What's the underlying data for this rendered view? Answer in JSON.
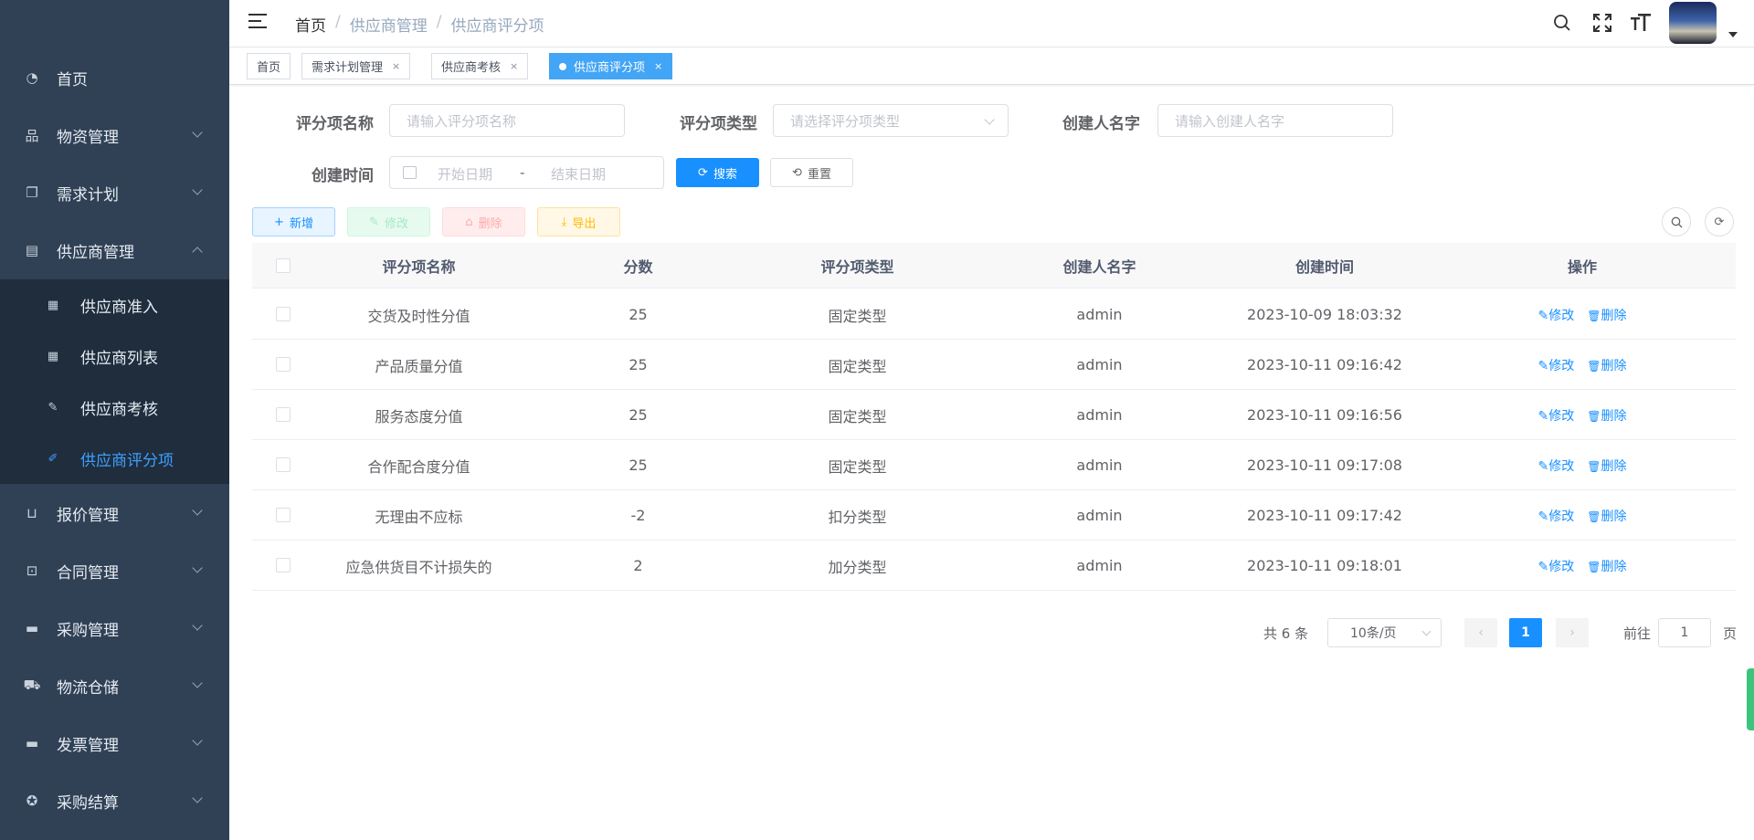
{
  "sidebar": {
    "items": [
      {
        "label": "首页",
        "icon": "dashboard-icon",
        "glyph": "◔"
      },
      {
        "label": "物资管理",
        "icon": "sitemap-icon",
        "glyph": "品"
      },
      {
        "label": "需求计划",
        "icon": "clipboard-icon",
        "glyph": "❐"
      },
      {
        "label": "供应商管理",
        "icon": "table-icon",
        "glyph": "▤"
      },
      {
        "label": "报价管理",
        "icon": "book-icon",
        "glyph": "⊔"
      },
      {
        "label": "合同管理",
        "icon": "briefcase-icon",
        "glyph": "⊡"
      },
      {
        "label": "采购管理",
        "icon": "document-icon",
        "glyph": "▬"
      },
      {
        "label": "物流仓储",
        "icon": "truck-icon",
        "glyph": "⛟"
      },
      {
        "label": "发票管理",
        "icon": "invoice-icon",
        "glyph": "▬"
      },
      {
        "label": "采购结算",
        "icon": "lifebuoy-icon",
        "glyph": "✪"
      }
    ],
    "sub_items": [
      {
        "label": "供应商准入",
        "icon": "grid-icon",
        "glyph": "▦"
      },
      {
        "label": "供应商列表",
        "icon": "grid-icon",
        "glyph": "▦"
      },
      {
        "label": "供应商考核",
        "icon": "edit-icon",
        "glyph": "✎"
      },
      {
        "label": "供应商评分项",
        "icon": "chart-edit-icon",
        "glyph": "✐"
      }
    ]
  },
  "header": {
    "breadcrumb": {
      "home": "首页",
      "sep": "/",
      "level1": "供应商管理",
      "level2": "供应商评分项"
    }
  },
  "tags": [
    {
      "label": "首页"
    },
    {
      "label": "需求计划管理",
      "close": "×"
    },
    {
      "label": "供应商考核",
      "close": "×"
    },
    {
      "label": "供应商评分项",
      "close": "×"
    }
  ],
  "search": {
    "name_label": "评分项名称",
    "name_placeholder": "请输入评分项名称",
    "type_label": "评分项类型",
    "type_placeholder": "请选择评分项类型",
    "creator_label": "创建人名字",
    "creator_placeholder": "请输入创建人名字",
    "time_label": "创建时间",
    "start_placeholder": "开始日期",
    "range_sep": "-",
    "end_placeholder": "结束日期",
    "search_btn": "搜索",
    "reset_btn": "重置"
  },
  "toolbar": {
    "add": "新增",
    "edit": "修改",
    "delete": "删除",
    "export": "导出"
  },
  "table": {
    "columns": [
      "评分项名称",
      "分数",
      "评分项类型",
      "创建人名字",
      "创建时间",
      "操作"
    ],
    "rows": [
      {
        "name": "交货及时性分值",
        "score": "25",
        "type": "固定类型",
        "creator": "admin",
        "time": "2023-10-09 18:03:32"
      },
      {
        "name": "产品质量分值",
        "score": "25",
        "type": "固定类型",
        "creator": "admin",
        "time": "2023-10-11 09:16:42"
      },
      {
        "name": "服务态度分值",
        "score": "25",
        "type": "固定类型",
        "creator": "admin",
        "time": "2023-10-11 09:16:56"
      },
      {
        "name": "合作配合度分值",
        "score": "25",
        "type": "固定类型",
        "creator": "admin",
        "time": "2023-10-11 09:17:08"
      },
      {
        "name": "无理由不应标",
        "score": "-2",
        "type": "扣分类型",
        "creator": "admin",
        "time": "2023-10-11 09:17:42"
      },
      {
        "name": "应急供货目不计损失的",
        "score": "2",
        "type": "加分类型",
        "creator": "admin",
        "time": "2023-10-11 09:18:01"
      }
    ],
    "row_edit": "修改",
    "row_delete": "删除"
  },
  "pagination": {
    "total": "共 6 条",
    "page_size": "10条/页",
    "current": "1",
    "goto_label": "前往",
    "goto_value": "1",
    "page_suffix": "页"
  },
  "colors": {
    "sidebar_bg": "#304156",
    "submenu_bg": "#1f2d3d",
    "primary": "#1890ff",
    "active_tag": "#42a5f5"
  }
}
